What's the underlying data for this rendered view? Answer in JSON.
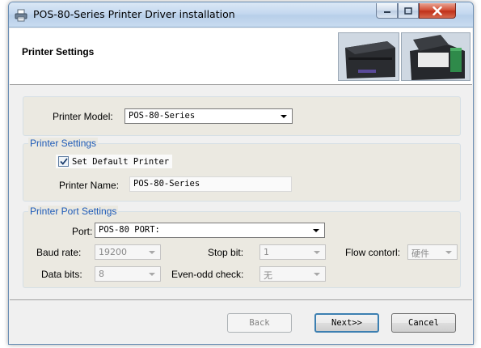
{
  "window": {
    "title": "POS-80-Series Printer Driver installation",
    "icon": "printer-icon"
  },
  "header": {
    "title": "Printer Settings"
  },
  "model_group": {
    "model_label": "Printer Model:",
    "model_value": "POS-80-Series"
  },
  "printer_settings": {
    "legend": "Printer Settings",
    "default_checkbox_label": "Set Default Printer",
    "default_checked": true,
    "name_label": "Printer Name:",
    "name_value": "POS-80-Series"
  },
  "port_settings": {
    "legend": "Printer Port Settings",
    "port_label": "Port:",
    "port_value": "POS-80 PORT:",
    "baud_label": "Baud rate:",
    "baud_value": "19200",
    "stop_label": "Stop bit:",
    "stop_value": "1",
    "flow_label": "Flow contorl:",
    "flow_value": "硬件",
    "data_label": "Data bits:",
    "data_value": "8",
    "parity_label": "Even-odd check:",
    "parity_value": "无"
  },
  "buttons": {
    "back": "Back",
    "next": "Next>>",
    "cancel": "Cancel"
  },
  "colors": {
    "legend_blue": "#1e5bb8",
    "close_red": "#c0311a",
    "group_bg": "#ebe9e1"
  }
}
